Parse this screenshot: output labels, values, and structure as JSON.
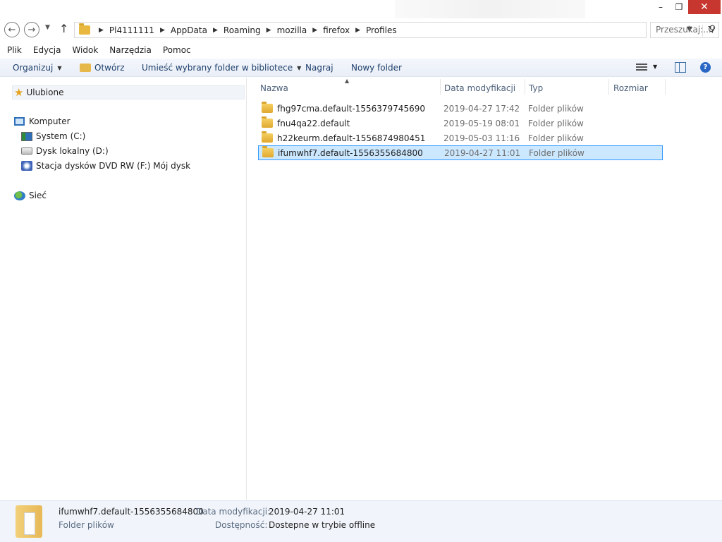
{
  "window": {
    "minimize": "–",
    "maximize": "❐",
    "close": "✕"
  },
  "address": {
    "crumbs": [
      "Pl4111111",
      "AppData",
      "Roaming",
      "mozilla",
      "firefox",
      "Profiles"
    ],
    "search_placeholder": "Przeszukaj:..."
  },
  "menu": [
    "Plik",
    "Edycja",
    "Widok",
    "Narzędzia",
    "Pomoc"
  ],
  "toolbar": {
    "organize": "Organizuj",
    "open": "Otwórz",
    "include_library": "Umieść wybrany folder w bibliotece",
    "burn": "Nagraj",
    "new_folder": "Nowy folder"
  },
  "nav": {
    "favorites": "Ulubione",
    "computer": "Komputer",
    "drive_c": "System (C:)",
    "drive_d": "Dysk lokalny (D:)",
    "drive_f": "Stacja dysków DVD RW (F:) Mój dysk",
    "network": "Sieć"
  },
  "columns": {
    "name": "Nazwa",
    "date": "Data modyfikacji",
    "type": "Typ",
    "size": "Rozmiar"
  },
  "files": [
    {
      "name": "fhg97cma.default-1556379745690",
      "date": "2019-04-27 17:42",
      "type": "Folder plików",
      "selected": false
    },
    {
      "name": "fnu4qa22.default",
      "date": "2019-05-19 08:01",
      "type": "Folder plików",
      "selected": false
    },
    {
      "name": "h22keurm.default-1556874980451",
      "date": "2019-05-03 11:16",
      "type": "Folder plików",
      "selected": false
    },
    {
      "name": "ifumwhf7.default-1556355684800",
      "date": "2019-04-27 11:01",
      "type": "Folder plików",
      "selected": true
    }
  ],
  "details": {
    "name": "ifumwhf7.default-1556355684800",
    "kind": "Folder plików",
    "modified_label": "Data modyfikacji:",
    "modified_value": "2019-04-27 11:01",
    "availability_label": "Dostępność:",
    "availability_value": "Dostepne w trybie offline"
  }
}
